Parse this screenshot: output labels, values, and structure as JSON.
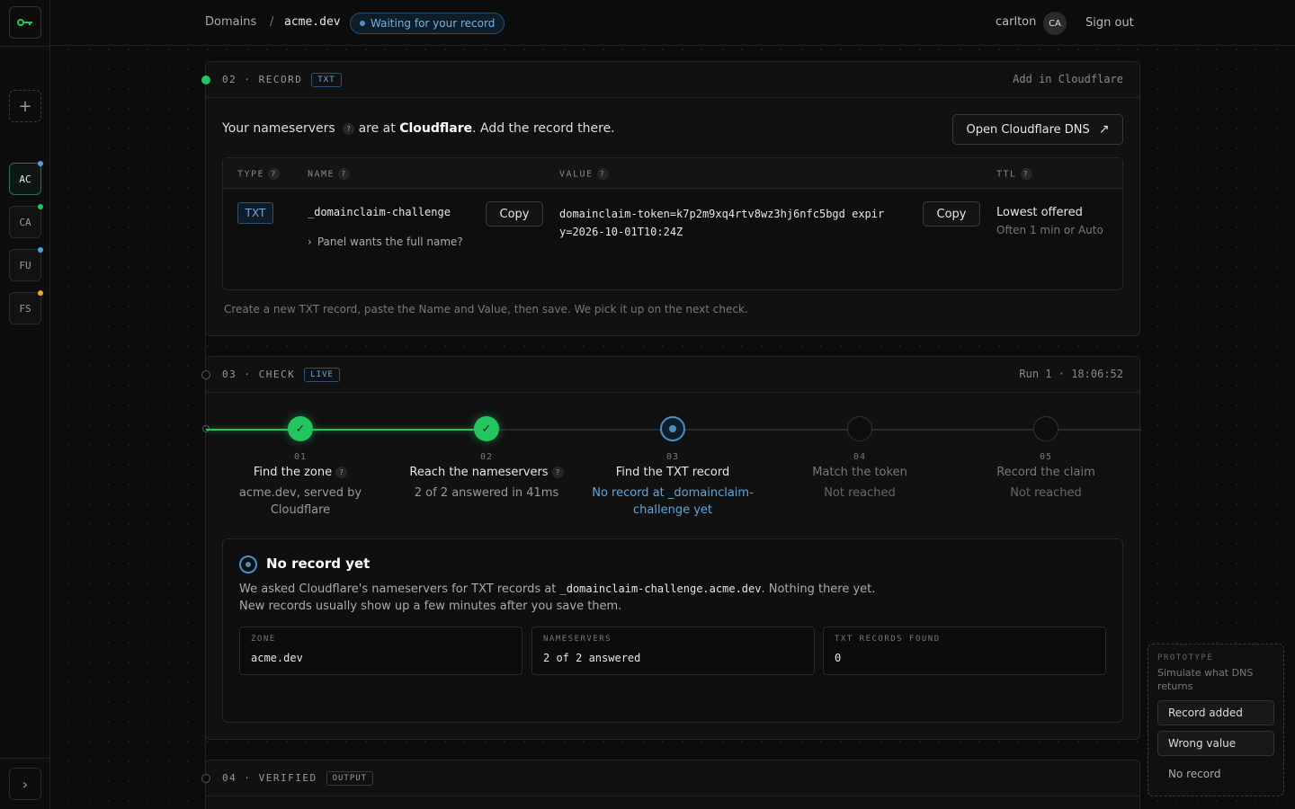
{
  "app": {
    "logo_icon": "key-icon",
    "add_label": "+",
    "accounts": [
      {
        "label": "AC",
        "dot": "#4aa3e0",
        "active": true
      },
      {
        "label": "CA",
        "dot": "#22c55e",
        "active": false
      },
      {
        "label": "FU",
        "dot": "#4aa3e0",
        "active": false
      },
      {
        "label": "FS",
        "dot": "#e8a33c",
        "active": false
      }
    ],
    "expand_icon": "chevron-right-icon"
  },
  "header": {
    "breadcrumb_root": "Domains",
    "breadcrumb_sep": "/",
    "breadcrumb_current": "acme.dev",
    "status": "Waiting for your record",
    "user": "carlton",
    "avatar": "CA",
    "signout": "Sign out"
  },
  "record": {
    "step_label": "02 · RECORD",
    "tag": "TXT",
    "right": "Add in Cloudflare",
    "intro_prefix": "Your nameservers",
    "intro_help": "?",
    "intro_mid": "are at",
    "intro_provider": "Cloudflare",
    "intro_suffix": ". Add the record there.",
    "open_button": "Open Cloudflare DNS",
    "columns": {
      "type": "TYPE",
      "name": "NAME",
      "value": "VALUE",
      "ttl": "TTL"
    },
    "row": {
      "type": "TXT",
      "name": "_domainclaim-challenge",
      "name_hint": "Panel wants the full name?",
      "value_line1": "domainclaim-token=k7p2m9xq4rtv8wz3hj6nfc5bgd expir",
      "value_line2": "y=2026-10-01T10:24Z",
      "copy_label": "Copy",
      "ttl": "Lowest offered",
      "ttl_sub": "Often 1 min or Auto"
    },
    "footnote": "Create a new TXT record, paste the Name and Value, then save. We pick it up on the next check."
  },
  "check": {
    "step_label": "03 · CHECK",
    "tag": "LIVE",
    "right": "Run 1 · 18:06:52",
    "steps": [
      {
        "num": "01",
        "title": "Find the zone",
        "sub": "acme.dev, served by Cloudflare",
        "state": "done"
      },
      {
        "num": "02",
        "title": "Reach the nameservers",
        "sub": "2 of 2 answered in 41ms",
        "state": "done"
      },
      {
        "num": "03",
        "title": "Find the TXT record",
        "sub": "No record at _domainclaim-challenge yet",
        "state": "active"
      },
      {
        "num": "04",
        "title": "Match the token",
        "sub": "Not reached",
        "state": "pending"
      },
      {
        "num": "05",
        "title": "Record the claim",
        "sub": "Not reached",
        "state": "pending"
      }
    ],
    "result": {
      "title": "No record yet",
      "line1_prefix": "We asked Cloudflare's nameservers for TXT records at ",
      "line1_code": "_domainclaim-challenge.acme.dev",
      "line1_suffix": ". Nothing there yet.",
      "line2": "New records usually show up a few minutes after you save them.",
      "metrics": [
        {
          "key": "ZONE",
          "value": "acme.dev"
        },
        {
          "key": "NAMESERVERS",
          "value": "2 of 2 answered"
        },
        {
          "key": "TXT RECORDS FOUND",
          "value": "0"
        }
      ]
    }
  },
  "verified": {
    "step_label": "04 · VERIFIED",
    "tag": "OUTPUT"
  },
  "prototype": {
    "label": "PROTOTYPE",
    "desc": "Simulate what DNS returns",
    "options": [
      "Record added",
      "Wrong value",
      "No record"
    ]
  },
  "colors": {
    "accent_green": "#22c55e",
    "accent_blue": "#4a90c4",
    "warning": "#e8a33c"
  }
}
